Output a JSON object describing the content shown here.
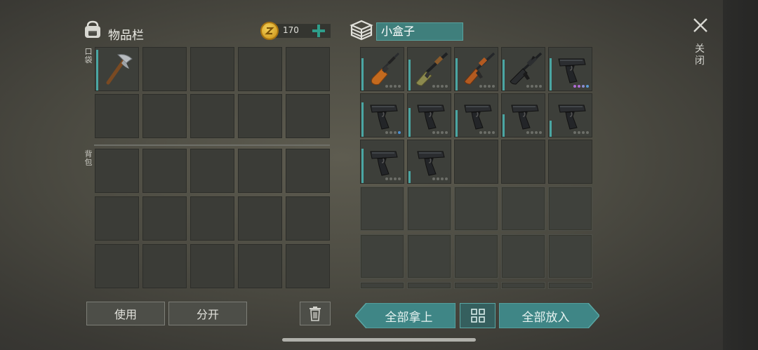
{
  "inventory": {
    "title": "物品栏",
    "coins": "170",
    "pocket_label": "口袋",
    "backpack_label": "背包"
  },
  "container": {
    "name": "小盒子"
  },
  "close_label": "关闭",
  "buttons": {
    "use": "使用",
    "split": "分开",
    "take_all": "全部拿上",
    "put_all": "全部放入"
  },
  "pocket_items": [
    {
      "name": "pickaxe-icon",
      "durability": 1.0
    }
  ],
  "box_items": [
    {
      "name": "hunting-rifle-icon",
      "durability": 0.8,
      "dot_colors": [
        "#6c6e68",
        "#6c6e68",
        "#6c6e68",
        "#6c6e68"
      ]
    },
    {
      "name": "shotgun-icon",
      "durability": 0.75,
      "dot_colors": [
        "#6c6e68",
        "#6c6e68",
        "#6c6e68",
        "#6c6e68"
      ]
    },
    {
      "name": "ak-rifle-icon",
      "durability": 0.8,
      "dot_colors": [
        "#6c6e68",
        "#6c6e68",
        "#6c6e68",
        "#6c6e68"
      ]
    },
    {
      "name": "m16-rifle-icon",
      "durability": 0.75,
      "dot_colors": [
        "#6c6e68",
        "#6c6e68",
        "#6c6e68",
        "#6c6e68"
      ]
    },
    {
      "name": "pistol-icon",
      "durability": 0.8,
      "dot_colors": [
        "#b06bd6",
        "#b06bd6",
        "#8b8dcf",
        "#5a9ad6"
      ]
    },
    {
      "name": "pistol-icon",
      "durability": 0.85,
      "dot_colors": [
        "#6c6e68",
        "#6c6e68",
        "#6c6e68",
        "#4a8fd0"
      ]
    },
    {
      "name": "pistol-icon",
      "durability": 0.7,
      "dot_colors": [
        "#6c6e68",
        "#6c6e68",
        "#6c6e68",
        "#6c6e68"
      ]
    },
    {
      "name": "pistol-icon",
      "durability": 0.65,
      "dot_colors": [
        "#6c6e68",
        "#6c6e68",
        "#6c6e68",
        "#6c6e68"
      ]
    },
    {
      "name": "pistol-icon",
      "durability": 0.55,
      "dot_colors": [
        "#6c6e68",
        "#6c6e68",
        "#6c6e68",
        "#6c6e68"
      ]
    },
    {
      "name": "pistol-icon",
      "durability": 0.4,
      "dot_colors": [
        "#6c6e68",
        "#6c6e68",
        "#6c6e68",
        "#6c6e68"
      ]
    },
    {
      "name": "pistol-icon",
      "durability": 0.85,
      "dot_colors": [
        "#6c6e68",
        "#6c6e68",
        "#6c6e68",
        "#6c6e68"
      ]
    },
    {
      "name": "pistol-icon",
      "durability": 0.3,
      "dot_colors": [
        "#6c6e68",
        "#6c6e68",
        "#6c6e68",
        "#6c6e68"
      ]
    }
  ],
  "colors": {
    "accent_teal": "#3f8686",
    "durability": "#4aa6a3",
    "coin_gold": "#d9a520",
    "add_green": "#2e9e8a"
  }
}
